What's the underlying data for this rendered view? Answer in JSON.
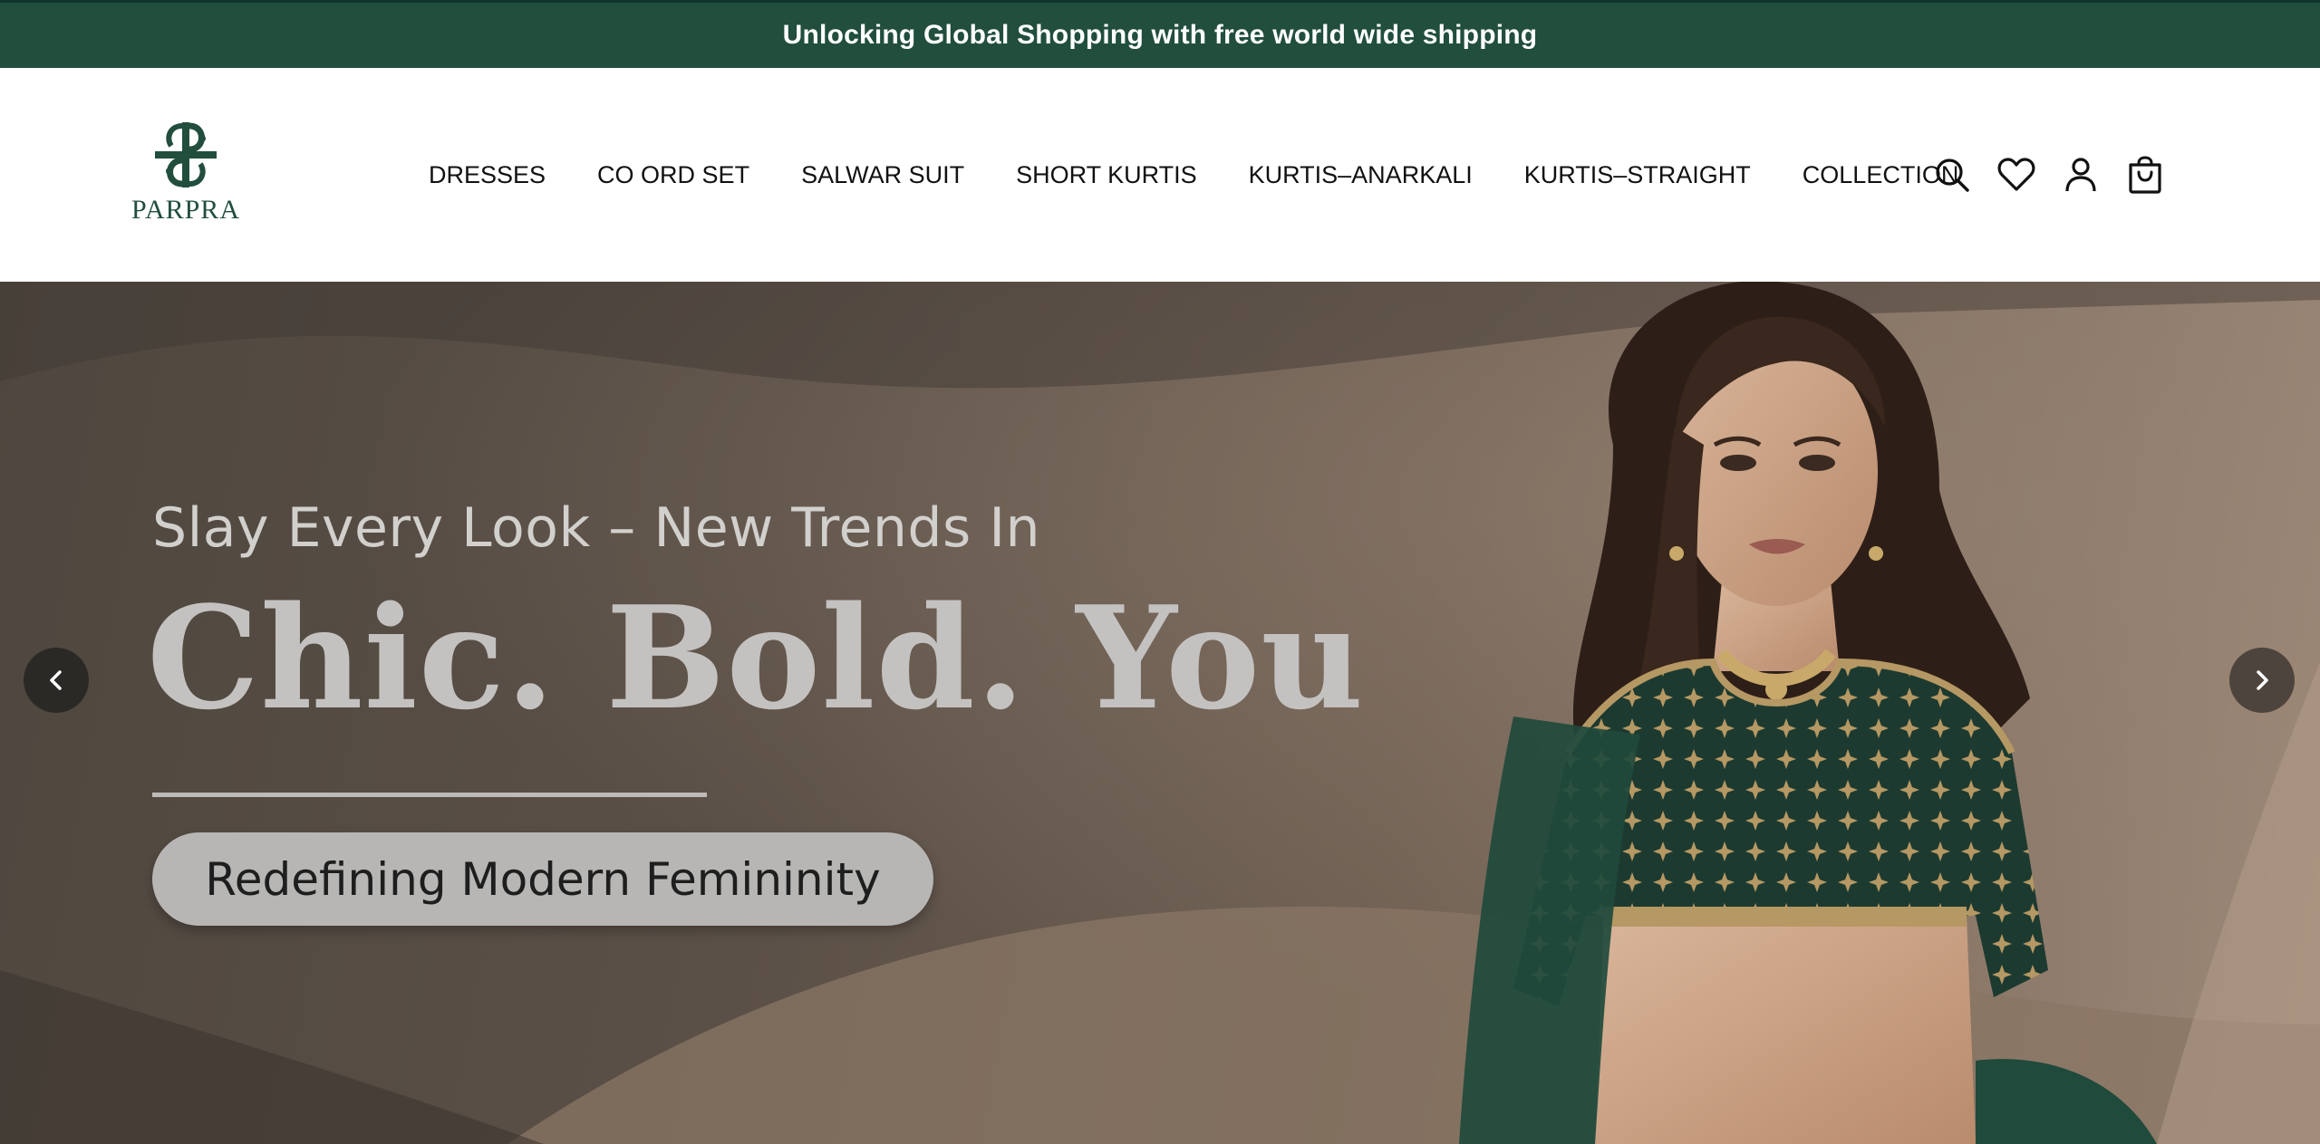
{
  "announcement": {
    "text": "Unlocking Global Shopping with free world wide shipping"
  },
  "header": {
    "logo_text": "PARPRA",
    "nav": [
      {
        "label": "DRESSES"
      },
      {
        "label": "CO ORD SET"
      },
      {
        "label": "SALWAR SUIT"
      },
      {
        "label": "SHORT KURTIS"
      },
      {
        "label": "KURTIS–ANARKALI"
      },
      {
        "label": "KURTIS–STRAIGHT"
      },
      {
        "label": "COLLECTION"
      }
    ],
    "icons": [
      "search-icon",
      "wishlist-heart-icon",
      "account-icon",
      "cart-bag-icon"
    ]
  },
  "hero": {
    "subtitle": "Slay Every Look – New Trends In",
    "title": "Chic. Bold. You",
    "tagline": "Redefining Modern Femininity",
    "prev_icon": "chevron-left-icon",
    "next_icon": "chevron-right-icon"
  },
  "colors": {
    "brand_green": "#214e3d",
    "hero_text": "#c4c2c0",
    "pill_bg": "#b7b6b4"
  }
}
